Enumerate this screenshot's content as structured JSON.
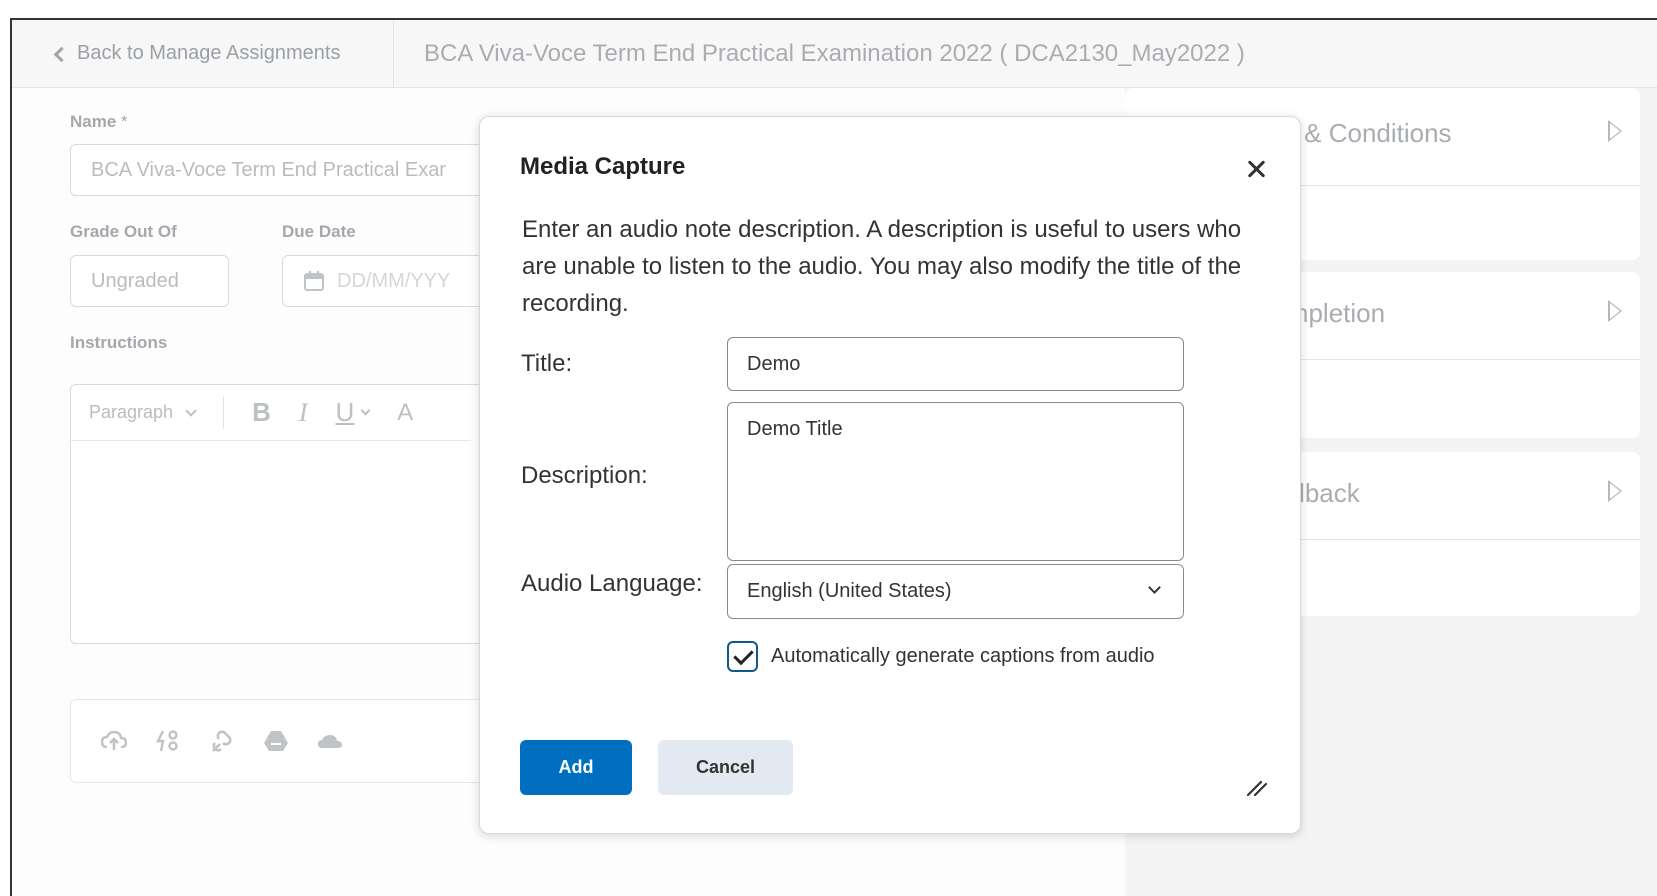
{
  "topbar": {
    "back_label": "Back to Manage Assignments",
    "page_title": "BCA Viva-Voce Term End Practical Examination 2022 ( DCA2130_May2022 )"
  },
  "form": {
    "name_label": "Name",
    "name_required_mark": "*",
    "name_value": "BCA Viva-Voce Term End Practical Exar",
    "grade_label": "Grade Out Of",
    "grade_value": "Ungraded",
    "due_label": "Due Date",
    "due_placeholder": "DD/MM/YYY",
    "instructions_label": "Instructions",
    "paragraph_style": "Paragraph",
    "bold_glyph": "B",
    "italic_glyph": "I",
    "underline_glyph": "U",
    "extra_glyph": "A"
  },
  "right_panel": {
    "sections": [
      {
        "title": "Dates & Conditions"
      },
      {
        "title": "& Completion"
      },
      {
        "title": "& Feedback"
      }
    ]
  },
  "dialog": {
    "title": "Media Capture",
    "description": "Enter an audio note description. A description is useful to users who are unable to listen to the audio. You may also modify the title of the recording.",
    "title_label": "Title:",
    "title_value": "Demo",
    "description_label": "Description:",
    "description_value": "Demo Title",
    "audio_language_label": "Audio Language:",
    "audio_language_value": "English (United States)",
    "captions_label": "Automatically generate captions from audio",
    "captions_checked": true,
    "add_label": "Add",
    "cancel_label": "Cancel"
  },
  "colors": {
    "primary": "#006fbf",
    "cancel_bg": "#e3e9f1"
  }
}
